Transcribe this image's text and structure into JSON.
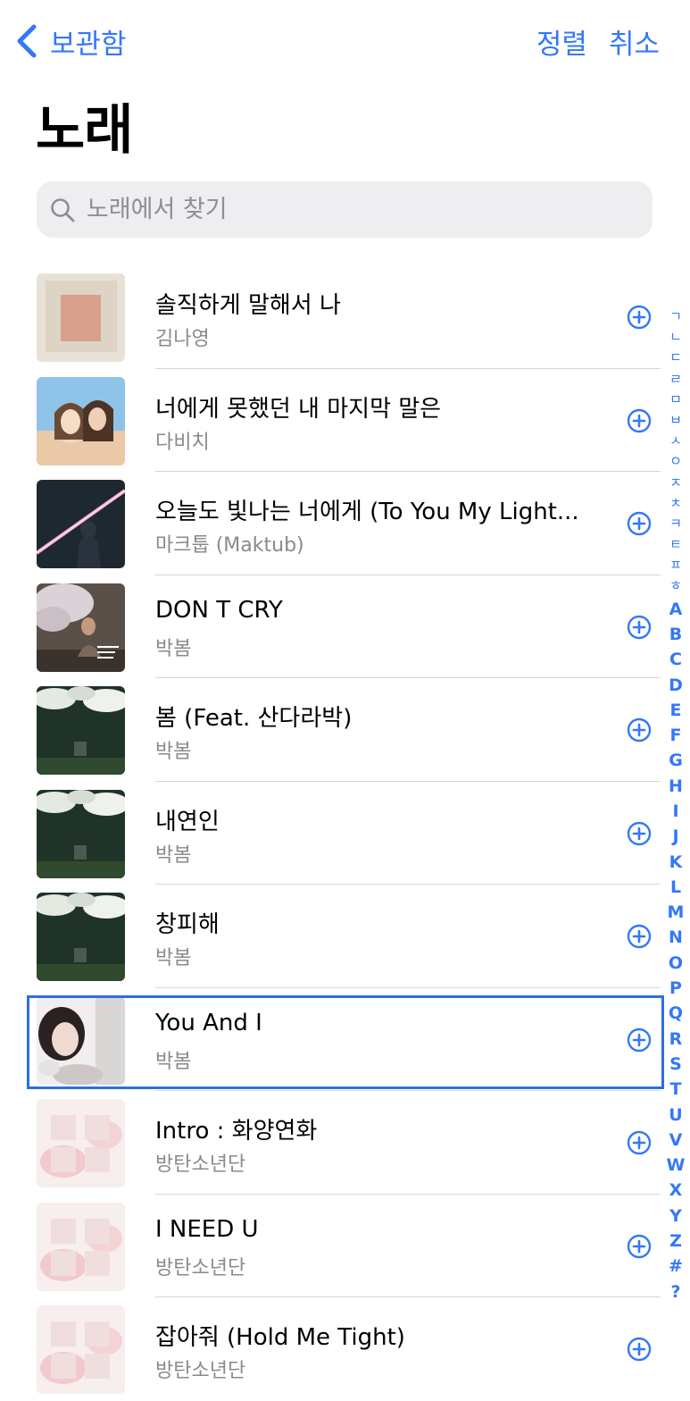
{
  "nav": {
    "back_label": "보관함",
    "sort_label": "정렬",
    "cancel_label": "취소"
  },
  "page_title": "노래",
  "search": {
    "placeholder": "노래에서 찾기",
    "value": ""
  },
  "songs": [
    {
      "title": "솔직하게 말해서 나",
      "artist": "김나영",
      "selected": false
    },
    {
      "title": "너에게 못했던 내 마지막 말은",
      "artist": "다비치",
      "selected": false
    },
    {
      "title": "오늘도 빛나는 너에게 (To You My Light...",
      "artist": "마크툽 (Maktub)",
      "selected": false
    },
    {
      "title": "DON T CRY",
      "artist": "박봄",
      "selected": false
    },
    {
      "title": "봄 (Feat. 산다라박)",
      "artist": "박봄",
      "selected": false
    },
    {
      "title": "내연인",
      "artist": "박봄",
      "selected": false
    },
    {
      "title": "창피해",
      "artist": "박봄",
      "selected": false
    },
    {
      "title": "You And I",
      "artist": "박봄",
      "selected": true
    },
    {
      "title": "Intro : 화양연화",
      "artist": "방탄소년단",
      "selected": false
    },
    {
      "title": "I NEED U",
      "artist": "방탄소년단",
      "selected": false
    },
    {
      "title": "잡아줘 (Hold Me Tight)",
      "artist": "방탄소년단",
      "selected": false
    }
  ],
  "index_letters": [
    "ㄱ",
    "ㄴ",
    "ㄷ",
    "ㄹ",
    "ㅁ",
    "ㅂ",
    "ㅅ",
    "ㅇ",
    "ㅈ",
    "ㅊ",
    "ㅋ",
    "ㅌ",
    "ㅍ",
    "ㅎ",
    "A",
    "B",
    "C",
    "D",
    "E",
    "F",
    "G",
    "H",
    "I",
    "J",
    "K",
    "L",
    "M",
    "N",
    "O",
    "P",
    "Q",
    "R",
    "S",
    "T",
    "U",
    "V",
    "W",
    "X",
    "Y",
    "Z",
    "#",
    "?"
  ],
  "colors": {
    "accent": "#3478f6",
    "highlight": "#2d6fe0",
    "secondary_text": "#8a8a8e",
    "search_bg": "#eeeef0"
  }
}
